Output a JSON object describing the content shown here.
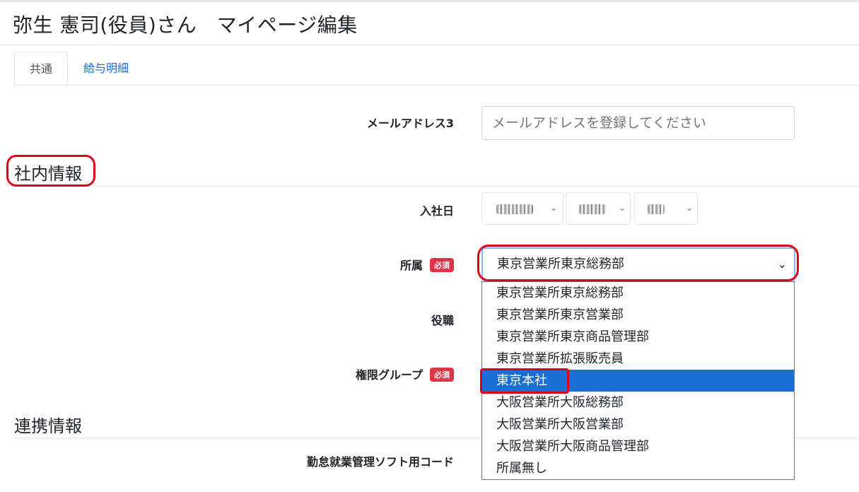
{
  "page": {
    "title": "弥生 憲司(役員)さん　マイページ編集"
  },
  "tabs": [
    {
      "label": "共通",
      "active": true
    },
    {
      "label": "給与明細",
      "active": false
    }
  ],
  "form": {
    "email3": {
      "label": "メールアドレス3",
      "placeholder": "メールアドレスを登録してください"
    },
    "section_company": "社内情報",
    "hire_date": {
      "label": "入社日"
    },
    "department": {
      "label": "所属",
      "badge": "必須",
      "value": "東京営業所東京総務部"
    },
    "position": {
      "label": "役職"
    },
    "permission_group": {
      "label": "権限グループ",
      "badge": "必須"
    },
    "section_link": "連携情報",
    "attendance_code": {
      "label": "勤怠就業管理ソフト用コード"
    }
  },
  "dropdown": {
    "options": [
      "東京営業所東京総務部",
      "東京営業所東京営業部",
      "東京営業所東京商品管理部",
      "東京営業所拡張販売員",
      "東京本社",
      "大阪営業所大阪総務部",
      "大阪営業所大阪営業部",
      "大阪営業所大阪商品管理部",
      "所属無し"
    ],
    "highlighted_index": 4
  },
  "colors": {
    "annotation_red": "#e0001b",
    "badge_red": "#dc3545",
    "link_blue": "#0d6efd",
    "selected_option": "#1a6fd3"
  },
  "icons": {
    "select_chevron": "chevron-down-icon"
  }
}
